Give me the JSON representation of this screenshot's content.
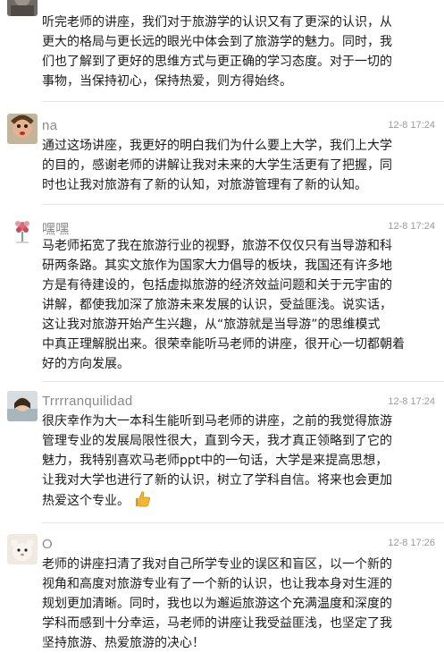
{
  "comments": [
    {
      "username": "",
      "timestamp": "",
      "lines": [
        "听完老师的讲座，我们对于旅游学的认识又有了更深的认识，从",
        "更大的格局与更长远的眼光中体会到了旅游学的魅力。同时，我",
        "们也了解到了更好的思维方式与更正确的学习态度。对于一切的",
        "事物，当保持初心，保持热爱，则方得始终。"
      ]
    },
    {
      "username": "na",
      "timestamp": "12-8 17:24",
      "lines": [
        "通过这场讲座，我更好的明白我们为什么要上大学，我们上大学",
        "的目的，感谢老师的讲解让我对未来的大学生活更有了把握，同",
        "时也让我对旅游有了新的认知，对旅游管理有了新的认知。"
      ]
    },
    {
      "username": "嘿嘿",
      "timestamp": "12-8 17:24",
      "lines": [
        "马老师拓宽了我在旅游行业的视野，旅游不仅仅只有当导游和科",
        "研两条路。其实文旅作为国家大力倡导的板块，我国还有许多地",
        "方是有待建设的，包括虚拟旅游的经济效益问题和关于元宇宙的",
        "讲解，都使我加深了旅游未来发展的认识，受益匪浅。说实话，",
        "这让我对旅游开始产生兴趣，从“旅游就是当导游”的思维模式",
        "中真正理解脱出来。很荣幸能听马老师的讲座，很开心一切都朝着",
        "好的方向发展。"
      ]
    },
    {
      "username": "Trrrranquilidad",
      "timestamp": "12-8 17:24",
      "lines": [
        "很庆幸作为大一本科生能听到马老师的讲座，之前的我觉得旅游",
        "管理专业的发展局限性很大，直到今天，我才真正领略到了它的",
        "魅力，我特别喜欢马老师ppt中的一句话，大学是来提高思想，",
        "让我对大学也进行了新的认识，树立了学科自信。将来也会更加",
        "热爱这个专业。"
      ]
    },
    {
      "username": "O",
      "timestamp": "12-8 17:26",
      "lines": [
        "老师的讲座扫清了我对自己所学专业的误区和盲区，以一个新的",
        "视角和高度对旅游专业有了一个新的认识，也让我本身对生涯的",
        "规划更加清晰。同时，我也以为邂逅旅游这个充满温度和深度的",
        "学科而感到十分幸运，马老师的讲座让我受益匪浅，也坚定了我",
        "坚持旅游、热爱旅游的决心！"
      ]
    }
  ],
  "icons": {
    "thumbs_up": "thumbs-up-emoji"
  }
}
